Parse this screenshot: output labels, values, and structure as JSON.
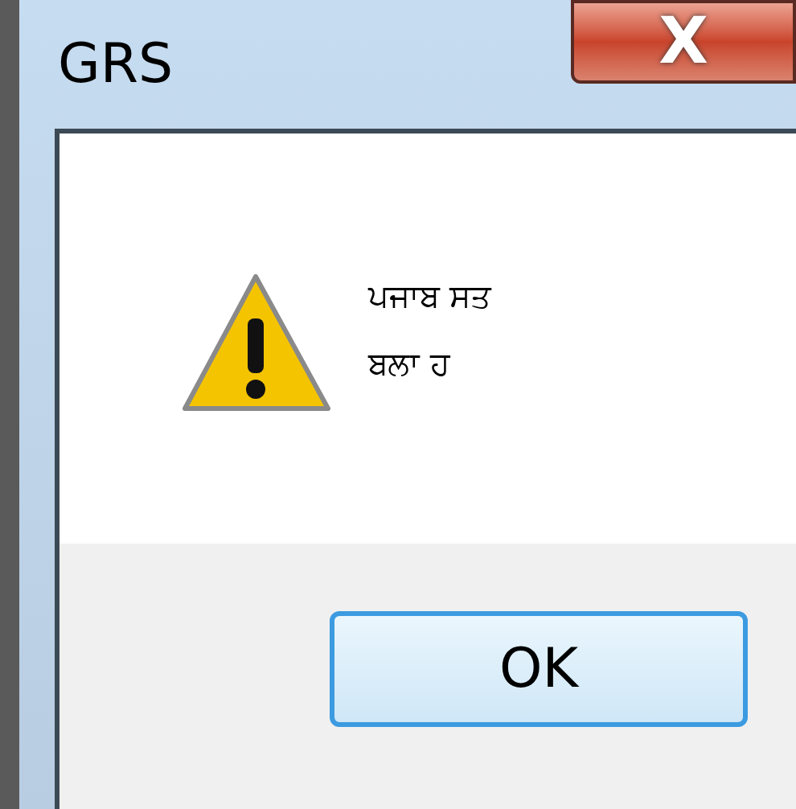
{
  "window": {
    "title": "GRS",
    "close_glyph": "X"
  },
  "message_lines": [
    "ਪਜਾਬ ਸਤ",
    "ਬਲਾ ਹ"
  ],
  "buttons": [
    {
      "label": "OK",
      "selected": true
    }
  ]
}
